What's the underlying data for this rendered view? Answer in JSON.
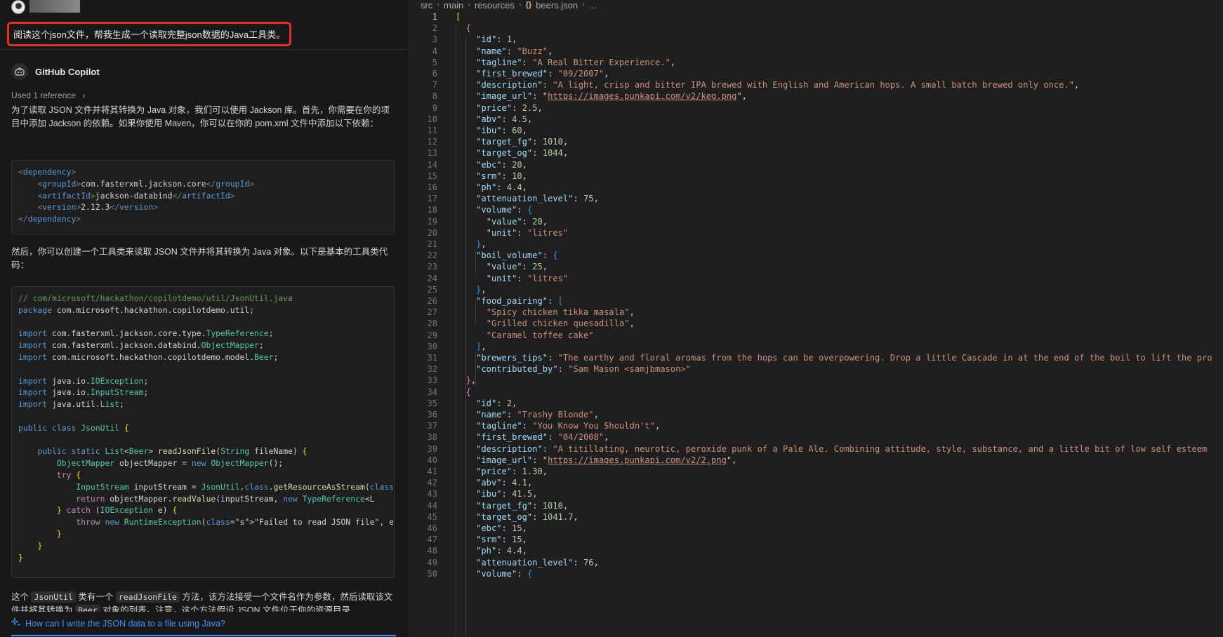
{
  "chat": {
    "user_message": "阅读这个json文件，帮我生成一个读取完整json数据的Java工具类。",
    "bot_name": "GitHub Copilot",
    "used_reference": "Used 1 reference",
    "para1": "为了读取 JSON 文件并将其转换为 Java 对象，我们可以使用 Jackson 库。首先，你需要在你的项目中添加 Jackson 的依赖。如果你使用 Maven，你可以在你的 pom.xml 文件中添加以下依赖：",
    "maven_code": [
      "<dependency>",
      "    <groupId>com.fasterxml.jackson.core</groupId>",
      "    <artifactId>jackson-databind</artifactId>",
      "    <version>2.12.3</version>",
      "</dependency>"
    ],
    "para2": "然后，你可以创建一个工具类来读取 JSON 文件并将其转换为 Java 对象。以下是基本的工具类代码：",
    "java_code": [
      "// com/microsoft/hackathon/copilotdemo/util/JsonUtil.java",
      "package com.microsoft.hackathon.copilotdemo.util;",
      "",
      "import com.fasterxml.jackson.core.type.TypeReference;",
      "import com.fasterxml.jackson.databind.ObjectMapper;",
      "import com.microsoft.hackathon.copilotdemo.model.Beer;",
      "",
      "import java.io.IOException;",
      "import java.io.InputStream;",
      "import java.util.List;",
      "",
      "public class JsonUtil {",
      "",
      "    public static List<Beer> readJsonFile(String fileName) {",
      "        ObjectMapper objectMapper = new ObjectMapper();",
      "        try {",
      "            InputStream inputStream = JsonUtil.class.getResourceAsStream(\"",
      "            return objectMapper.readValue(inputStream, new TypeReference<L",
      "        } catch (IOException e) {",
      "            throw new RuntimeException(\"Failed to read JSON file\", e);",
      "        }",
      "    }",
      "}"
    ],
    "para3_a": "这个 ",
    "para3_code1": "JsonUtil",
    "para3_b": " 类有一个 ",
    "para3_code2": "readJsonFile",
    "para3_c": " 方法，该方法接受一个文件名作为参数，然后读取该文件并将其转换为 ",
    "para3_code3": "Beer",
    "para3_d": " 对象的列表。注意，这个方法假设 JSON 文件位于你的资源目录",
    "suggestion": "How can I write the JSON data to a file using Java?"
  },
  "editor": {
    "breadcrumbs": [
      "src",
      "main",
      "resources",
      "beers.json",
      "..."
    ],
    "active_line": 1
  },
  "json_lines": [
    "[",
    "  {",
    "    \"id\": 1,",
    "    \"name\": \"Buzz\",",
    "    \"tagline\": \"A Real Bitter Experience.\",",
    "    \"first_brewed\": \"09/2007\",",
    "    \"description\": \"A light, crisp and bitter IPA brewed with English and American hops. A small batch brewed only once.\",",
    "    \"image_url\": \"https://images.punkapi.com/v2/keg.png\",",
    "    \"price\": 2.5,",
    "    \"abv\": 4.5,",
    "    \"ibu\": 60,",
    "    \"target_fg\": 1010,",
    "    \"target_og\": 1044,",
    "    \"ebc\": 20,",
    "    \"srm\": 10,",
    "    \"ph\": 4.4,",
    "    \"attenuation_level\": 75,",
    "    \"volume\": {",
    "      \"value\": 20,",
    "      \"unit\": \"litres\"",
    "    },",
    "    \"boil_volume\": {",
    "      \"value\": 25,",
    "      \"unit\": \"litres\"",
    "    },",
    "    \"food_pairing\": [",
    "      \"Spicy chicken tikka masala\",",
    "      \"Grilled chicken quesadilla\",",
    "      \"Caramel toffee cake\"",
    "    ],",
    "    \"brewers_tips\": \"The earthy and floral aromas from the hops can be overpowering. Drop a little Cascade in at the end of the boil to lift the pro",
    "    \"contributed_by\": \"Sam Mason <samjbmason>\"",
    "  },",
    "  {",
    "    \"id\": 2,",
    "    \"name\": \"Trashy Blonde\",",
    "    \"tagline\": \"You Know You Shouldn't\",",
    "    \"first_brewed\": \"04/2008\",",
    "    \"description\": \"A titillating, neurotic, peroxide punk of a Pale Ale. Combining attitude, style, substance, and a little bit of low self esteem",
    "    \"image_url\": \"https://images.punkapi.com/v2/2.png\",",
    "    \"price\": 1.30,",
    "    \"abv\": 4.1,",
    "    \"ibu\": 41.5,",
    "    \"target_fg\": 1010,",
    "    \"target_og\": 1041.7,",
    "    \"ebc\": 15,",
    "    \"srm\": 15,",
    "    \"ph\": 4.4,",
    "    \"attenuation_level\": 76,",
    "    \"volume\": {"
  ]
}
